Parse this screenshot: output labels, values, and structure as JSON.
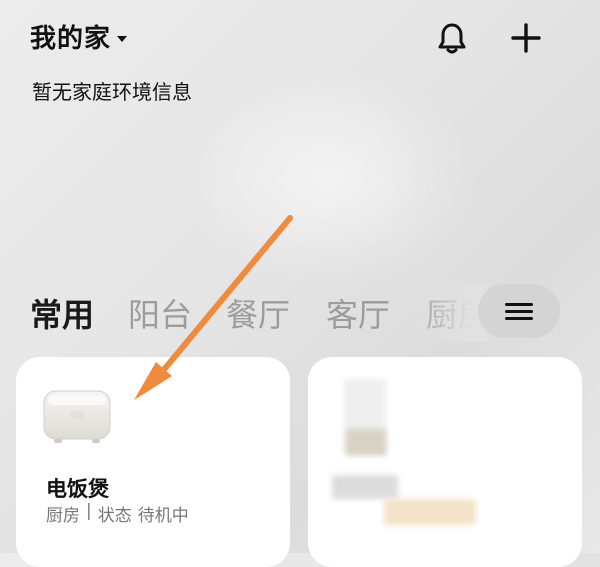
{
  "header": {
    "home_title": "我的家",
    "env_info": "暂无家庭环境信息"
  },
  "icons": {
    "bell": "bell-icon",
    "add": "plus-icon",
    "menu": "menu-icon",
    "caret": "caret-down-icon"
  },
  "tabs": [
    {
      "label": "常用",
      "active": true
    },
    {
      "label": "阳台",
      "active": false
    },
    {
      "label": "餐厅",
      "active": false
    },
    {
      "label": "客厅",
      "active": false
    },
    {
      "label": "厨房",
      "active": false
    }
  ],
  "devices": [
    {
      "name": "电饭煲",
      "room": "厨房",
      "separator": "|",
      "status_label": "状态",
      "status_value": "待机中"
    }
  ],
  "colors": {
    "accent_arrow": "#F08A3C",
    "tab_active": "#1A1A1A",
    "tab_inactive": "#9C9C9C"
  }
}
